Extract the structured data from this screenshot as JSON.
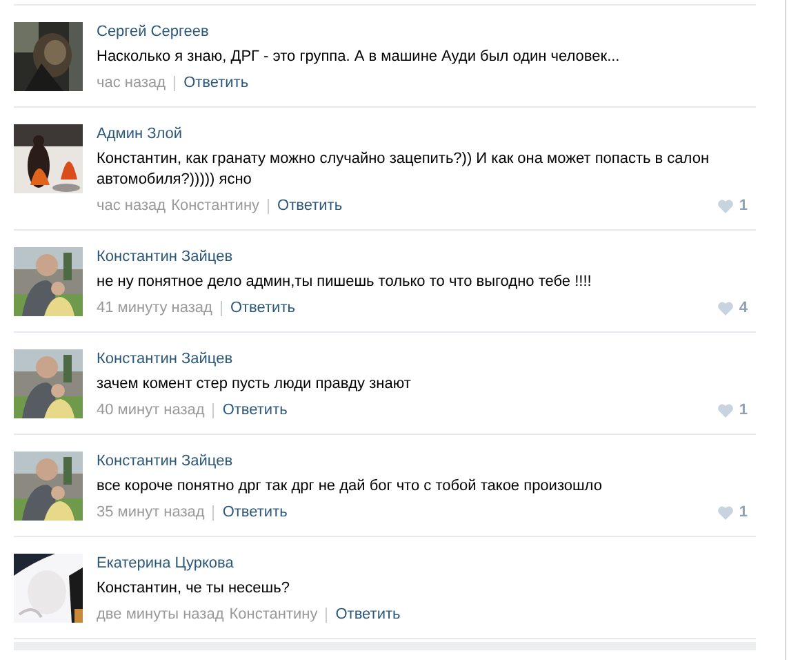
{
  "comments": [
    {
      "author": "Сергей Сергеев",
      "text": "Насколько я знаю, ДРГ - это группа. А в машине Ауди был один человек...",
      "time": "час назад",
      "reply": "Ответить"
    },
    {
      "author": "Админ Злой",
      "text": "Константин, как гранату можно случайно зацепить?)) И как она может попасть в салон автомобиля?))))) ясно",
      "time": "час назад",
      "reply_to": "Константину",
      "reply": "Ответить",
      "likes": "1"
    },
    {
      "author": "Константин Зайцев",
      "text": "не ну понятное дело админ,ты пишешь только то что выгодно тебе !!!!",
      "time": "41 минуту назад",
      "reply": "Ответить",
      "likes": "4"
    },
    {
      "author": "Константин Зайцев",
      "text": "зачем комент стер пусть люди правду знают",
      "time": "40 минут назад",
      "reply": "Ответить",
      "likes": "1"
    },
    {
      "author": "Константин Зайцев",
      "text": "все короче понятно дрг так дрг не дай бог что с тобой такое произошло",
      "time": "35 минут назад",
      "reply": "Ответить",
      "likes": "1"
    },
    {
      "author": "Екатерина Цуркова",
      "text": "Константин, че ты несешь?",
      "time": "две минуты назад",
      "reply_to": "Константину",
      "reply": "Ответить"
    }
  ]
}
